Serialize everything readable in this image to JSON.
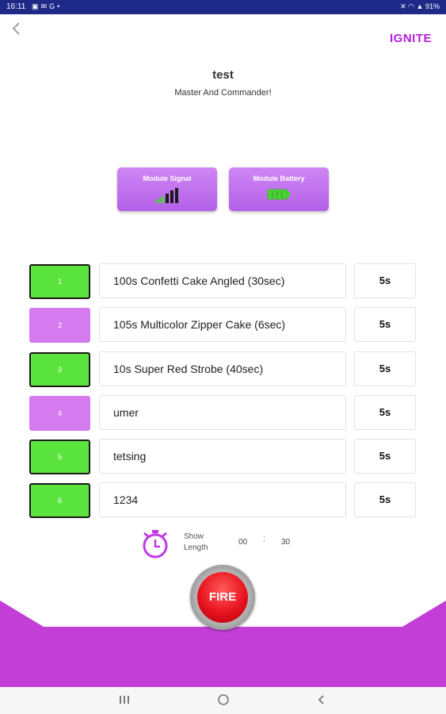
{
  "status_bar": {
    "time": "16:11",
    "notification_icons": [
      "image-icon",
      "mail-icon",
      "google-icon",
      "dot-icon"
    ],
    "battery": "91%"
  },
  "header": {
    "brand": "IGNITE",
    "title": "test",
    "subtitle": "Master And Commander!"
  },
  "module_cards": [
    {
      "label": "Module Signal",
      "icon": "signal-bars-icon"
    },
    {
      "label": "Module Battery",
      "icon": "battery-icon"
    }
  ],
  "cues": [
    {
      "number": "1",
      "name": "100s Confetti Cake Angled (30sec)",
      "duration": "5s",
      "state": "green"
    },
    {
      "number": "2",
      "name": "105s Multicolor Zipper Cake (6sec)",
      "duration": "5s",
      "state": "purple"
    },
    {
      "number": "3",
      "name": "10s Super Red Strobe (40sec)",
      "duration": "5s",
      "state": "green"
    },
    {
      "number": "4",
      "name": "umer",
      "duration": "5s",
      "state": "purple"
    },
    {
      "number": "5",
      "name": "tetsing",
      "duration": "5s",
      "state": "green"
    },
    {
      "number": "6",
      "name": "1234",
      "duration": "5s",
      "state": "green"
    }
  ],
  "show_length": {
    "label_line1": "Show",
    "label_line2": "Length",
    "minutes": "00",
    "separator": ":",
    "seconds": "30"
  },
  "fire_button": {
    "label": "FIRE"
  },
  "colors": {
    "accent_purple": "#b51ee0",
    "band_purple": "#c23ed6",
    "armed_green": "#5be33e",
    "idle_purple": "#d47bf0",
    "fire_red": "#e8141f",
    "status_bar": "#1f2a88"
  }
}
